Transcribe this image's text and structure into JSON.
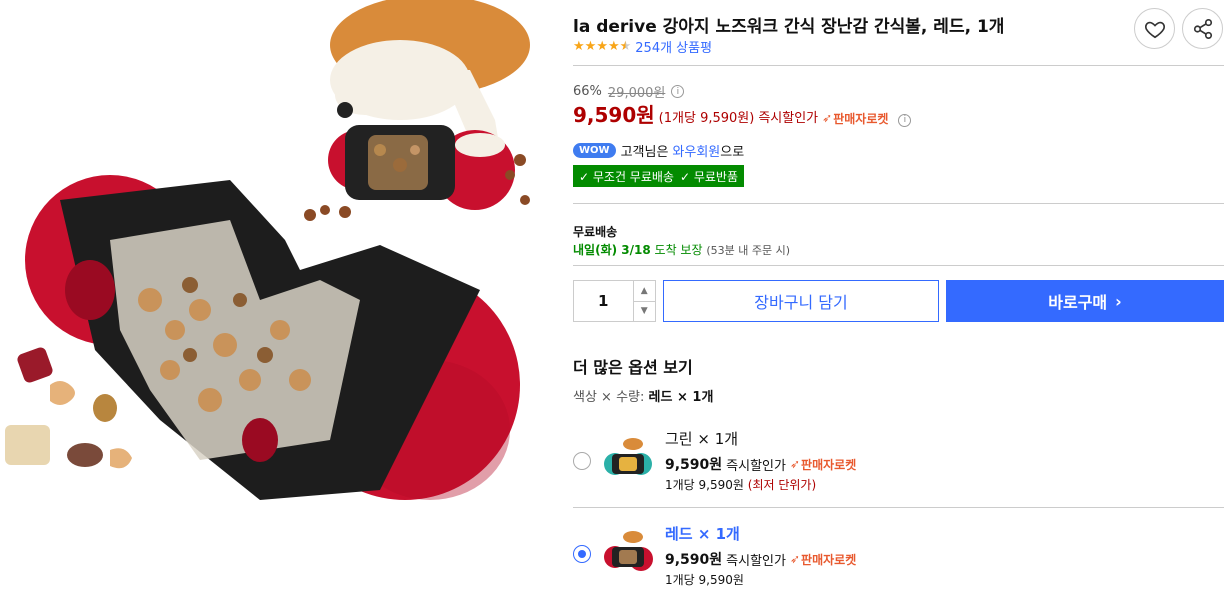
{
  "product": {
    "title": "la derive 강아지 노즈워크 간식 장난감 간식볼, 레드, 1개",
    "rating": 4.5,
    "review_count": "254개 상품평"
  },
  "price": {
    "discount_rate": "66%",
    "original_price": "29,000원",
    "sale_price": "9,590원",
    "unit_price": "(1개당 9,590원)",
    "instant_label": "즉시할인가",
    "seller_rocket": "판매자로켓"
  },
  "wow": {
    "badge": "WOW",
    "text_before": "고객님은",
    "member": "와우회원",
    "text_after": "으로"
  },
  "badges": {
    "free_shipping": "✓ 무조건 무료배송",
    "free_return": "✓ 무료반품"
  },
  "shipping": {
    "label": "무료배송",
    "eta": "내일(화) 3/18",
    "eta_suffix": "도착 보장",
    "note": "(53분 내 주문 시)"
  },
  "purchase": {
    "quantity": "1",
    "cart_label": "장바구니 담기",
    "buy_label": "바로구매"
  },
  "options": {
    "heading": "더 많은 옵션 보기",
    "summary_prefix": "색상 × 수량:",
    "summary_value": "레드 × 1개",
    "items": [
      {
        "name": "그린 × 1개",
        "price": "9,590원",
        "instant": "즉시할인가",
        "rocket": "판매자로켓",
        "unit": "1개당 9,590원",
        "lowest": "(최저 단위가)",
        "selected": false
      },
      {
        "name": "레드 × 1개",
        "price": "9,590원",
        "instant": "즉시할인가",
        "rocket": "판매자로켓",
        "unit": "1개당 9,590원",
        "lowest": "",
        "selected": true
      }
    ]
  },
  "colors": {
    "sale_red": "#ae0000",
    "coupang_blue": "#346aff",
    "free_green": "#038b00",
    "star": "#f8a518",
    "toy_red": "#c8102e"
  },
  "icons": [
    "heart-icon",
    "share-icon",
    "info-icon",
    "rocket-icon",
    "chevron-right-icon",
    "radio-icon"
  ]
}
